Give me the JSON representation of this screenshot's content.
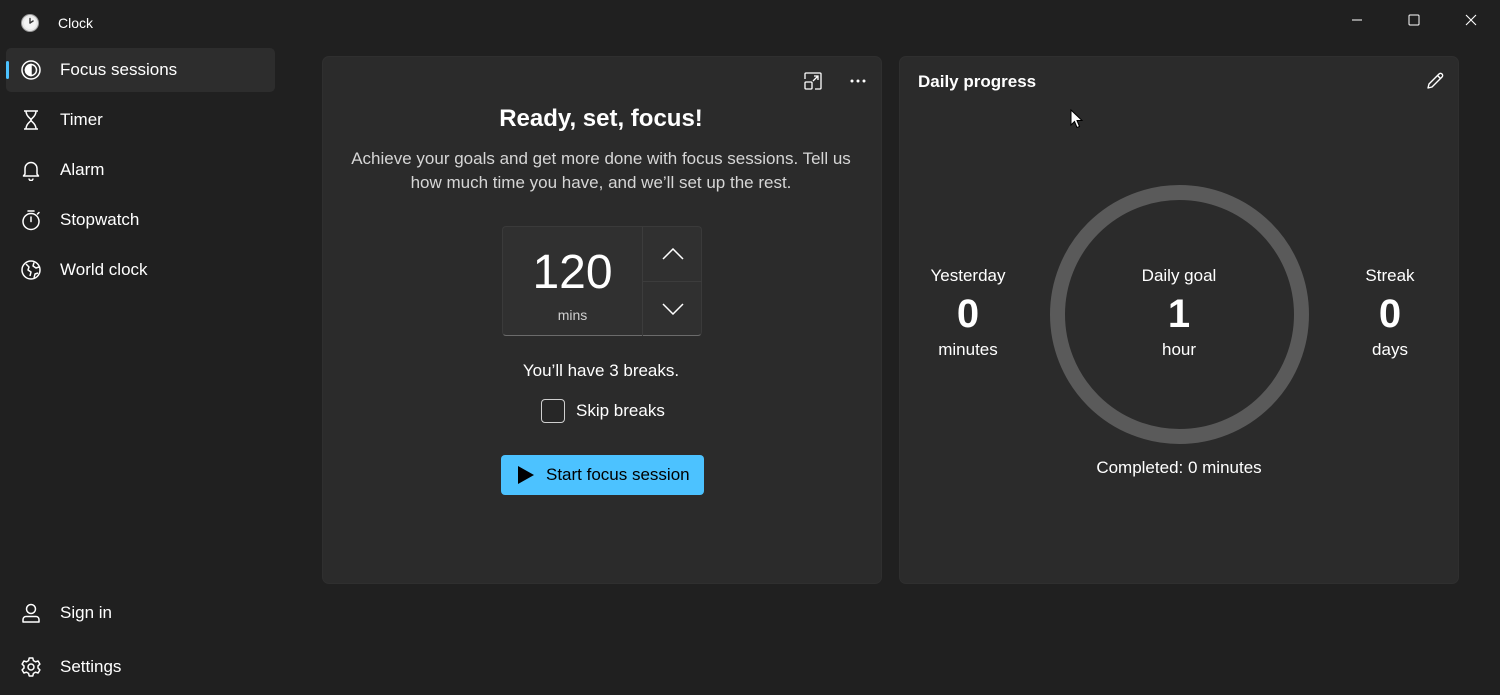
{
  "app": {
    "title": "Clock"
  },
  "sidebar": {
    "items": [
      {
        "label": "Focus sessions",
        "icon": "focus-icon",
        "active": true
      },
      {
        "label": "Timer",
        "icon": "hourglass-icon",
        "active": false
      },
      {
        "label": "Alarm",
        "icon": "bell-icon",
        "active": false
      },
      {
        "label": "Stopwatch",
        "icon": "stopwatch-icon",
        "active": false
      },
      {
        "label": "World clock",
        "icon": "globe-icon",
        "active": false
      }
    ],
    "footer": [
      {
        "label": "Sign in",
        "icon": "person-icon"
      },
      {
        "label": "Settings",
        "icon": "gear-icon"
      }
    ]
  },
  "focus": {
    "title": "Ready, set, focus!",
    "description": "Achieve your goals and get more done with focus sessions. Tell us how much time you have, and we’ll set up the rest.",
    "duration_value": "120",
    "duration_unit": "mins",
    "breaks_text": "You’ll have 3 breaks.",
    "skip_breaks_label": "Skip breaks",
    "skip_breaks_checked": false,
    "start_label": "Start focus session"
  },
  "progress": {
    "title": "Daily progress",
    "yesterday": {
      "label": "Yesterday",
      "value": "0",
      "unit": "minutes"
    },
    "goal": {
      "label": "Daily goal",
      "value": "1",
      "unit": "hour"
    },
    "streak": {
      "label": "Streak",
      "value": "0",
      "unit": "days"
    },
    "completed_text": "Completed: 0 minutes",
    "completion_fraction": 0
  },
  "colors": {
    "accent": "#4cc2ff",
    "background": "#202020",
    "card": "#2b2b2b",
    "ring_track": "#5a5a5a"
  }
}
